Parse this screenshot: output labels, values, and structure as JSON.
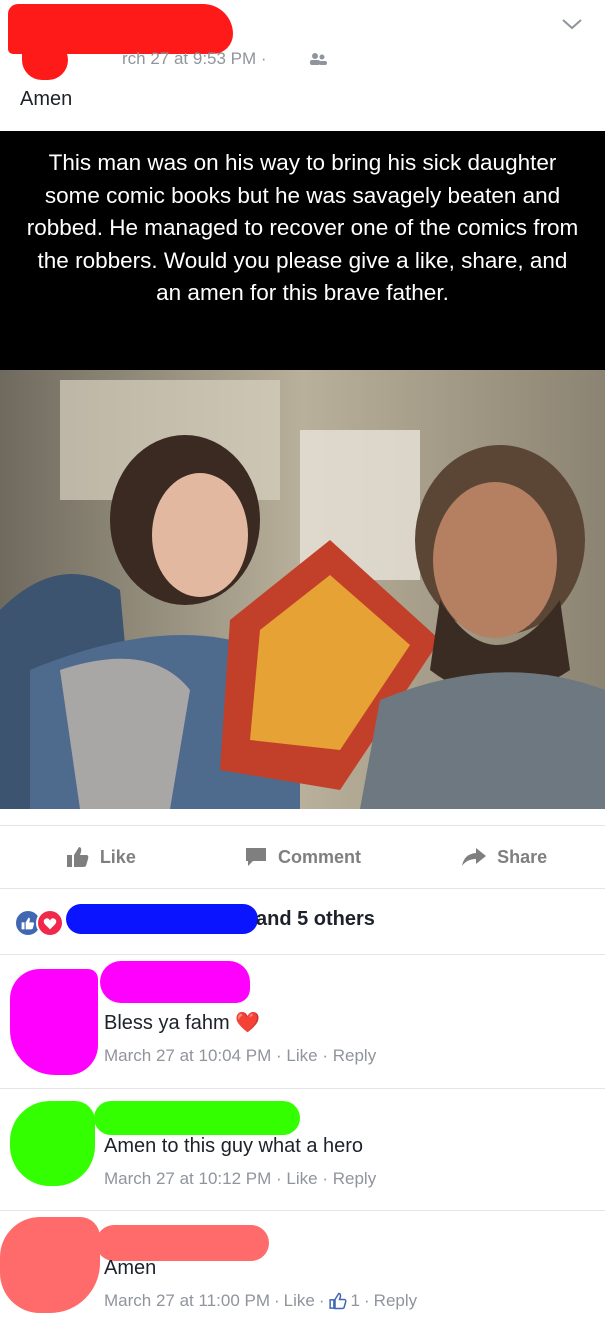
{
  "post": {
    "timestamp": "rch 27 at 9:53 PM ·",
    "audience_icon": "friends-icon",
    "chevron_icon": "chevron-down-icon",
    "text": "Amen",
    "image_caption": "This man was on his way to bring his sick daughter some comic books but he was savagely beaten and robbed. He managed to recover one of the comics from the robbers. Would you please give a like, share, and an amen for this brave father."
  },
  "actions": {
    "like": "Like",
    "comment": "Comment",
    "share": "Share"
  },
  "reactions": {
    "summary": "and 5 others",
    "icons": [
      "like-reaction-icon",
      "love-reaction-icon"
    ]
  },
  "comments": [
    {
      "text": "Bless ya fahm",
      "emoji": "❤️",
      "time": "March 27 at 10:04 PM",
      "like": "Like",
      "reply": "Reply",
      "sep": "·"
    },
    {
      "text": "Amen to this guy what a hero",
      "time": "March 27 at 10:12 PM",
      "like": "Like",
      "reply": "Reply",
      "sep": "·"
    },
    {
      "text": "Amen",
      "time": "March 27 at 11:00 PM",
      "like": "Like",
      "reply": "Reply",
      "likes_count": "1",
      "sep": "·"
    }
  ],
  "colors": {
    "redaction_red": "#ff1a1a",
    "redaction_blue": "#0a14ff",
    "redaction_magenta": "#ff00ff",
    "redaction_green": "#33ff00",
    "redaction_salmon": "#ff6b6b",
    "fb_blue": "#3b5998"
  }
}
